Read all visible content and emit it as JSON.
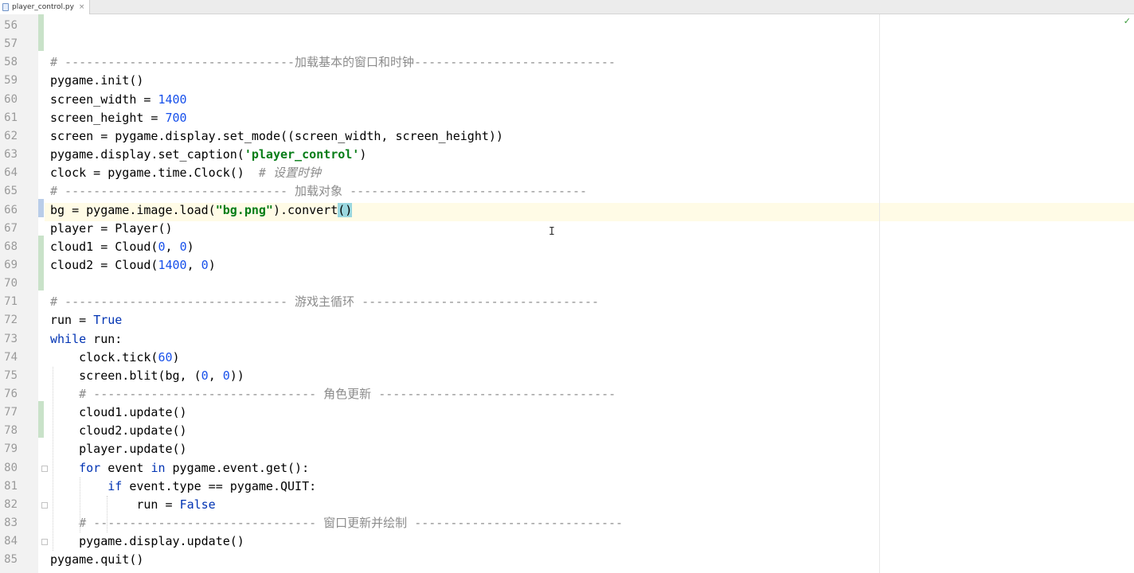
{
  "tab": {
    "filename": "player_control.py"
  },
  "colors": {
    "keyword": "#0033b3",
    "number": "#1750eb",
    "string": "#067d17",
    "comment": "#8c8c8c",
    "caret_line": "#fffbe6",
    "changed_marker": "#c9e2c9",
    "check": "#3a9a3a"
  },
  "status": {
    "analysis_icon": "check-mark-icon"
  },
  "lines": [
    {
      "no": "56",
      "segments": []
    },
    {
      "no": "57",
      "segments": []
    },
    {
      "no": "58",
      "segments": [
        {
          "t": "# --------------------------------加载基本的窗口和时钟----------------------------",
          "c": "cmdash"
        }
      ]
    },
    {
      "no": "59",
      "segments": [
        {
          "t": "pygame.init()",
          "c": ""
        }
      ]
    },
    {
      "no": "60",
      "segments": [
        {
          "t": "screen_width = ",
          "c": ""
        },
        {
          "t": "1400",
          "c": "num"
        }
      ]
    },
    {
      "no": "61",
      "segments": [
        {
          "t": "screen_height = ",
          "c": ""
        },
        {
          "t": "700",
          "c": "num"
        }
      ]
    },
    {
      "no": "62",
      "segments": [
        {
          "t": "screen = pygame.display.set_mode((screen_width, screen_height))",
          "c": ""
        }
      ]
    },
    {
      "no": "63",
      "segments": [
        {
          "t": "pygame.display.set_caption(",
          "c": ""
        },
        {
          "t": "'player_control'",
          "c": "str"
        },
        {
          "t": ")",
          "c": ""
        }
      ]
    },
    {
      "no": "64",
      "segments": [
        {
          "t": "clock = pygame.time.Clock()  ",
          "c": ""
        },
        {
          "t": "# 设置时钟",
          "c": "cm"
        }
      ]
    },
    {
      "no": "65",
      "segments": [
        {
          "t": "# ------------------------------- 加载对象 ---------------------------------",
          "c": "cmdash"
        }
      ]
    },
    {
      "no": "66",
      "segments": [
        {
          "t": "bg = pygame.image.load(",
          "c": ""
        },
        {
          "t": "\"bg.png\"",
          "c": "str"
        },
        {
          "t": ").convert",
          "c": ""
        },
        {
          "t": "()",
          "c": "bm"
        }
      ]
    },
    {
      "no": "67",
      "segments": [
        {
          "t": "player = Player()",
          "c": ""
        }
      ]
    },
    {
      "no": "68",
      "segments": [
        {
          "t": "cloud1 = Cloud(",
          "c": ""
        },
        {
          "t": "0",
          "c": "num"
        },
        {
          "t": ", ",
          "c": ""
        },
        {
          "t": "0",
          "c": "num"
        },
        {
          "t": ")",
          "c": ""
        }
      ]
    },
    {
      "no": "69",
      "segments": [
        {
          "t": "cloud2 = Cloud(",
          "c": ""
        },
        {
          "t": "1400",
          "c": "num"
        },
        {
          "t": ", ",
          "c": ""
        },
        {
          "t": "0",
          "c": "num"
        },
        {
          "t": ")",
          "c": ""
        }
      ]
    },
    {
      "no": "70",
      "segments": []
    },
    {
      "no": "71",
      "segments": [
        {
          "t": "# ------------------------------- 游戏主循环 ---------------------------------",
          "c": "cmdash"
        }
      ]
    },
    {
      "no": "72",
      "segments": [
        {
          "t": "run = ",
          "c": ""
        },
        {
          "t": "True",
          "c": "kw"
        }
      ]
    },
    {
      "no": "73",
      "segments": [
        {
          "t": "while",
          "c": "kw"
        },
        {
          "t": " run:",
          "c": ""
        }
      ]
    },
    {
      "no": "74",
      "segments": [
        {
          "t": "    clock.tick(",
          "c": ""
        },
        {
          "t": "60",
          "c": "num"
        },
        {
          "t": ")",
          "c": ""
        }
      ]
    },
    {
      "no": "75",
      "segments": [
        {
          "t": "    screen.blit(bg, (",
          "c": ""
        },
        {
          "t": "0",
          "c": "num"
        },
        {
          "t": ", ",
          "c": ""
        },
        {
          "t": "0",
          "c": "num"
        },
        {
          "t": "))",
          "c": ""
        }
      ]
    },
    {
      "no": "76",
      "segments": [
        {
          "t": "    # ------------------------------- 角色更新 ---------------------------------",
          "c": "cmdash"
        }
      ]
    },
    {
      "no": "77",
      "segments": [
        {
          "t": "    cloud1.update()",
          "c": ""
        }
      ]
    },
    {
      "no": "78",
      "segments": [
        {
          "t": "    cloud2.update()",
          "c": ""
        }
      ]
    },
    {
      "no": "79",
      "segments": [
        {
          "t": "    player.update()",
          "c": ""
        }
      ]
    },
    {
      "no": "80",
      "segments": [
        {
          "t": "    ",
          "c": ""
        },
        {
          "t": "for",
          "c": "kw"
        },
        {
          "t": " event ",
          "c": ""
        },
        {
          "t": "in",
          "c": "kw"
        },
        {
          "t": " pygame.event.get():",
          "c": ""
        }
      ]
    },
    {
      "no": "81",
      "segments": [
        {
          "t": "        ",
          "c": ""
        },
        {
          "t": "if",
          "c": "kw"
        },
        {
          "t": " event.type == pygame.QUIT:",
          "c": ""
        }
      ]
    },
    {
      "no": "82",
      "segments": [
        {
          "t": "            run = ",
          "c": ""
        },
        {
          "t": "False",
          "c": "kw"
        }
      ]
    },
    {
      "no": "83",
      "segments": [
        {
          "t": "    # ------------------------------- 窗口更新并绘制 -----------------------------",
          "c": "cmdash"
        }
      ]
    },
    {
      "no": "84",
      "segments": [
        {
          "t": "    pygame.display.update()",
          "c": ""
        }
      ]
    },
    {
      "no": "85",
      "segments": [
        {
          "t": "pygame.quit()",
          "c": ""
        }
      ]
    }
  ]
}
